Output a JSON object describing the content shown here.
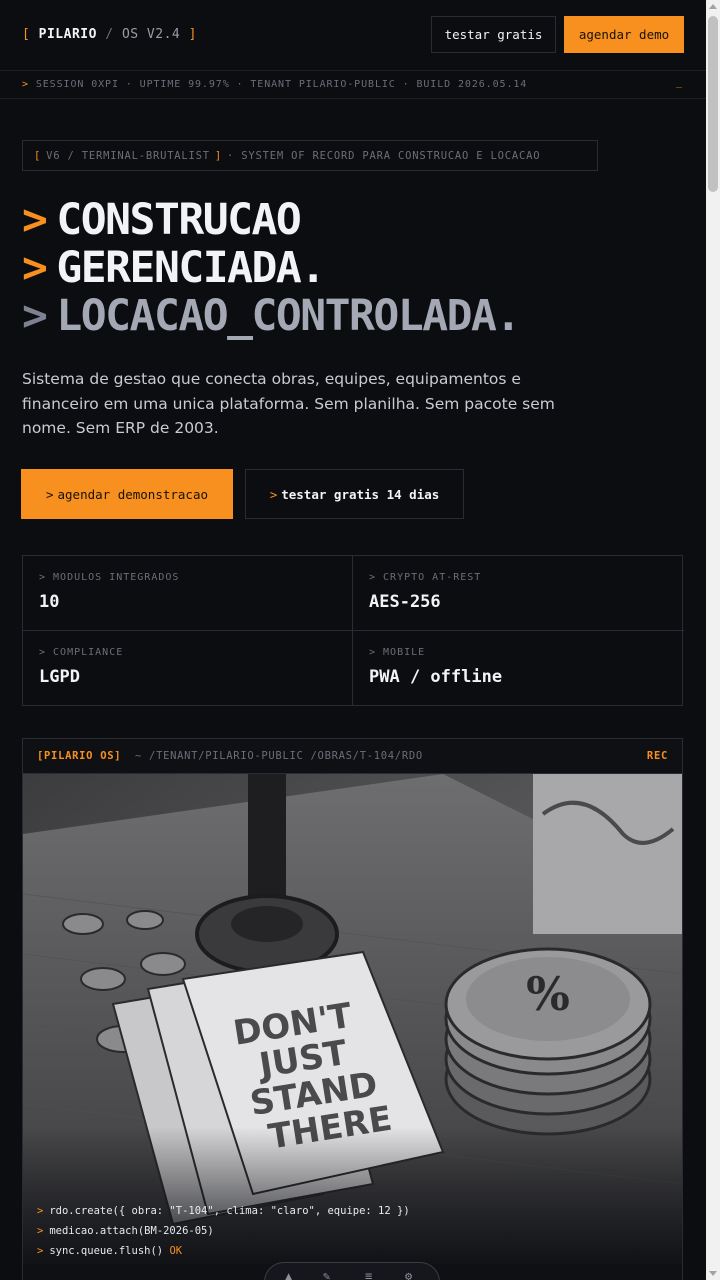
{
  "header": {
    "bracket_open": "[",
    "brand": "PILARIO",
    "slash": "/",
    "version": "OS V2.4",
    "bracket_close": "]",
    "btn_trial": "testar gratis",
    "btn_demo": "agendar demo"
  },
  "status": {
    "prompt": ">",
    "text": "SESSION 0XPI · UPTIME 99.97% · TENANT PILARIO-PUBLIC · BUILD 2026.05.14",
    "cursor": "_"
  },
  "tag": {
    "open": "[",
    "label": "V6 / TERMINAL-BRUTALIST",
    "close": "]",
    "rest": "· SYSTEM OF RECORD PARA CONSTRUCAO E LOCACAO"
  },
  "hero": {
    "prompt": ">",
    "line1": "CONSTRUCAO",
    "line2": "GERENCIADA.",
    "line3": "LOCACAO_CONTROLADA."
  },
  "lead": "Sistema de gestao que conecta obras, equipes, equipamentos e financeiro em uma unica plataforma. Sem planilha. Sem pacote sem nome. Sem ERP de 2003.",
  "cta": {
    "prompt": ">",
    "primary": "agendar demonstracao",
    "secondary": "testar gratis 14 dias"
  },
  "stats": [
    {
      "label": "> MODULOS INTEGRADOS",
      "value": "10"
    },
    {
      "label": "> CRYPTO AT-REST",
      "value": "AES-256"
    },
    {
      "label": "> COMPLIANCE",
      "value": "LGPD"
    },
    {
      "label": "> MOBILE",
      "value": "PWA / offline"
    }
  ],
  "panel": {
    "title": "[PILARIO OS]",
    "path": "~ /TENANT/PILARIO-PUBLIC /OBRAS/T-104/RDO",
    "rec": "REC",
    "photo_text": "DON'T JUST STAND THERE",
    "console": [
      {
        "prompt": ">",
        "cmd": "rdo.create({ obra: \"T-104\", clima: \"claro\", equipe: 12 })",
        "ok": ""
      },
      {
        "prompt": ">",
        "cmd": "medicao.attach(BM-2026-05)",
        "ok": ""
      },
      {
        "prompt": ">",
        "cmd": "sync.queue.flush()",
        "ok": "OK"
      }
    ]
  },
  "colors": {
    "background": "#0c0d11",
    "accent": "#f7901e",
    "border": "#2a2c34",
    "text": "#f2f3f6",
    "muted": "#6b6e78"
  }
}
